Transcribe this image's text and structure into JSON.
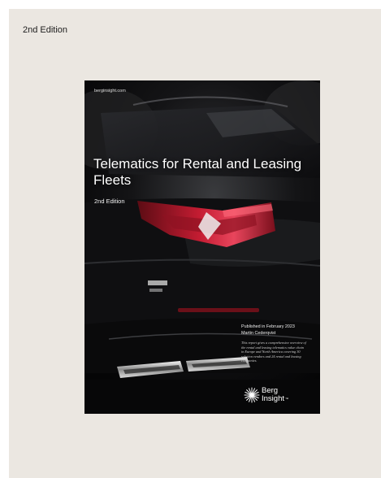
{
  "page": {
    "edition_label": "2nd Edition"
  },
  "cover": {
    "site": "berginsight.com",
    "title": "Telematics for Rental and Leasing Fleets",
    "subtitle": "2nd Edition",
    "published": "Published in February 2023",
    "author": "Martin Cederqvist",
    "description": "This report gives a comprehensive overview of the rental and leasing telematics value chain in Europe and North America covering 30 solution vendors and 24 rental and leasing companies.",
    "logo": {
      "line1": "Berg",
      "line2": "Insight",
      "trademark": "™",
      "icon": "starburst-icon"
    }
  }
}
